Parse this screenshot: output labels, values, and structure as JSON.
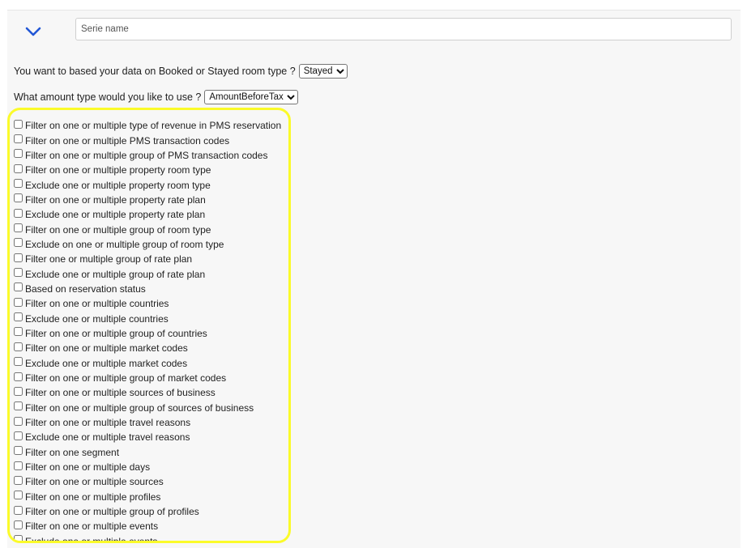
{
  "serie": {
    "placeholder": "Serie name",
    "value": ""
  },
  "icons": {
    "toggle": "chevron-down-icon",
    "accent": "#2257d6"
  },
  "room_type_question": {
    "label": "You want to based your data on Booked or Stayed room type ?",
    "selected": "Stayed"
  },
  "amount_question": {
    "label": "What amount type would you like to use ?",
    "selected": "AmountBeforeTax"
  },
  "highlight_color": "#fbfb2a",
  "filters": [
    {
      "label": "Filter on one or multiple type of revenue in PMS reservation",
      "checked": false
    },
    {
      "label": "Filter on one or multiple PMS transaction codes",
      "checked": false
    },
    {
      "label": "Filter on one or multiple group of PMS transaction codes",
      "checked": false
    },
    {
      "label": "Filter on one or multiple property room type",
      "checked": false
    },
    {
      "label": "Exclude one or multiple property room type",
      "checked": false
    },
    {
      "label": "Filter on one or multiple property rate plan",
      "checked": false
    },
    {
      "label": "Exclude one or multiple property rate plan",
      "checked": false
    },
    {
      "label": "Filter on one or multiple group of room type",
      "checked": false
    },
    {
      "label": "Exclude on one or multiple group of room type",
      "checked": false
    },
    {
      "label": "Filter one or multiple group of rate plan",
      "checked": false
    },
    {
      "label": "Exclude one or multiple group of rate plan",
      "checked": false
    },
    {
      "label": "Based on reservation status",
      "checked": false
    },
    {
      "label": "Filter on one or multiple countries",
      "checked": false
    },
    {
      "label": "Exclude one or multiple countries",
      "checked": false
    },
    {
      "label": "Filter on one or multiple group of countries",
      "checked": false
    },
    {
      "label": "Filter on one or multiple market codes",
      "checked": false
    },
    {
      "label": "Exclude one or multiple market codes",
      "checked": false
    },
    {
      "label": "Filter on one or multiple group of market codes",
      "checked": false
    },
    {
      "label": "Filter on one or multiple sources of business",
      "checked": false
    },
    {
      "label": "Filter on one or multiple group of sources of business",
      "checked": false
    },
    {
      "label": "Filter on one or multiple travel reasons",
      "checked": false
    },
    {
      "label": "Exclude one or multiple travel reasons",
      "checked": false
    },
    {
      "label": "Filter on one segment",
      "checked": false
    },
    {
      "label": "Filter on one or multiple days",
      "checked": false
    },
    {
      "label": "Filter on one or multiple sources",
      "checked": false
    },
    {
      "label": "Filter on one or multiple profiles",
      "checked": false
    },
    {
      "label": "Filter on one or multiple group of profiles",
      "checked": false
    },
    {
      "label": "Filter on one or multiple events",
      "checked": false
    },
    {
      "label": "Exclude one or multiple events",
      "checked": false
    }
  ]
}
